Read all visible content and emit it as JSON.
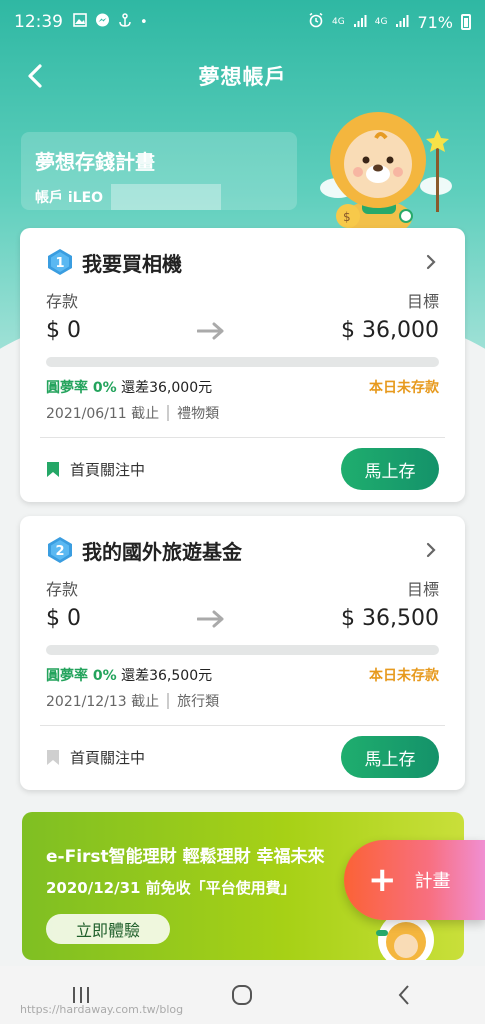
{
  "status_bar": {
    "time": "12:39",
    "battery": "71%",
    "net1": "4G",
    "net2": "4G"
  },
  "header": {
    "title": "夢想帳戶"
  },
  "plan_banner": {
    "title": "夢想存錢計畫",
    "account_label": "帳戶 iLEO"
  },
  "cards": [
    {
      "index": "1",
      "title": "我要買相機",
      "deposit_label": "存款",
      "target_label": "目標",
      "deposit_value": "$ 0",
      "target_value": "$ 36,000",
      "progress": 0,
      "rate_label": "圓夢率",
      "rate_value": "0%",
      "remaining": "還差36,000元",
      "today_status": "本日未存款",
      "deadline": "2021/06/11 截止",
      "category": "禮物類",
      "follow_label": "首頁關注中",
      "followed": true,
      "save_label": "馬上存"
    },
    {
      "index": "2",
      "title": "我的國外旅遊基金",
      "deposit_label": "存款",
      "target_label": "目標",
      "deposit_value": "$ 0",
      "target_value": "$ 36,500",
      "progress": 0,
      "rate_label": "圓夢率",
      "rate_value": "0%",
      "remaining": "還差36,500元",
      "today_status": "本日未存款",
      "deadline": "2021/12/13 截止",
      "category": "旅行類",
      "follow_label": "首頁關注中",
      "followed": false,
      "save_label": "馬上存"
    }
  ],
  "promo": {
    "title": "e-First智能理財 輕鬆理財 幸福未來",
    "subtitle": "2020/12/31 前免收「平台使用費」",
    "button": "立即體驗"
  },
  "fab": {
    "plus": "+",
    "label": "計畫"
  },
  "watermark": "https://hardaway.com.tw/blog",
  "colors": {
    "primary": "#2fb8a3",
    "green": "#23a35c",
    "orange": "#e79a1e",
    "fab": "#fb6236"
  }
}
